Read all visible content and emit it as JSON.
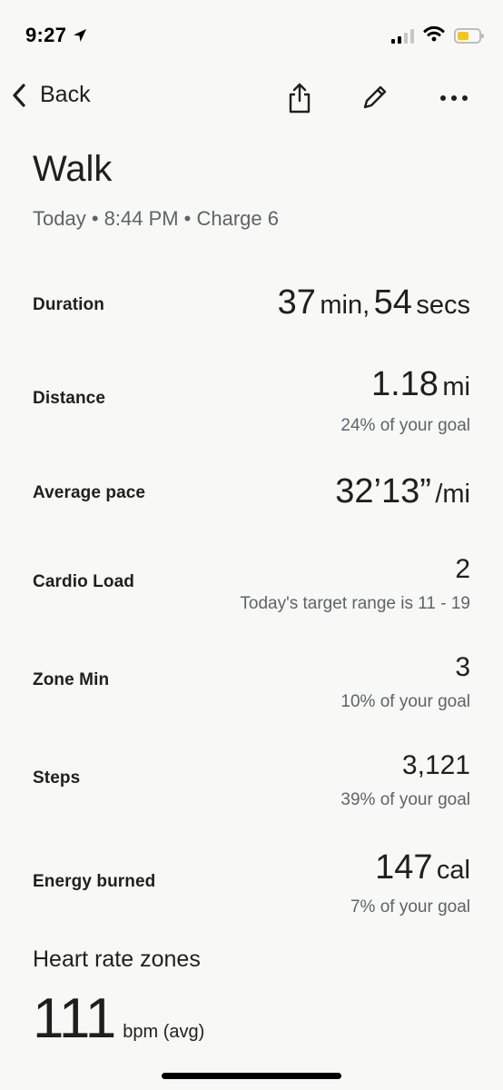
{
  "status_bar": {
    "time": "9:27",
    "battery_color": "#f5c518"
  },
  "nav": {
    "back_label": "Back"
  },
  "header": {
    "title": "Walk",
    "subtitle": "Today • 8:44 PM • Charge 6"
  },
  "metrics": {
    "duration": {
      "label": "Duration",
      "minutes": "37",
      "min_unit": "min,",
      "seconds": "54",
      "sec_unit": "secs"
    },
    "distance": {
      "label": "Distance",
      "value": "1.18",
      "unit": "mi",
      "sub": "24% of your goal"
    },
    "pace": {
      "label": "Average pace",
      "value": "32’13”",
      "unit": "/mi"
    },
    "cardio_load": {
      "label": "Cardio Load",
      "value": "2",
      "sub": "Today's target range is 11 - 19"
    },
    "zone_min": {
      "label": "Zone Min",
      "value": "3",
      "sub": "10% of your goal"
    },
    "steps": {
      "label": "Steps",
      "value": "3,121",
      "sub": "39% of your goal"
    },
    "energy": {
      "label": "Energy burned",
      "value": "147",
      "unit": "cal",
      "sub": "7% of your goal"
    }
  },
  "heart_rate": {
    "section_title": "Heart rate zones",
    "value": "111",
    "unit": "bpm (avg)"
  },
  "icons": [
    "location-arrow-icon",
    "signal-icon",
    "wifi-icon",
    "battery-icon",
    "back-chevron-icon",
    "share-icon",
    "edit-pencil-icon",
    "more-icon"
  ]
}
